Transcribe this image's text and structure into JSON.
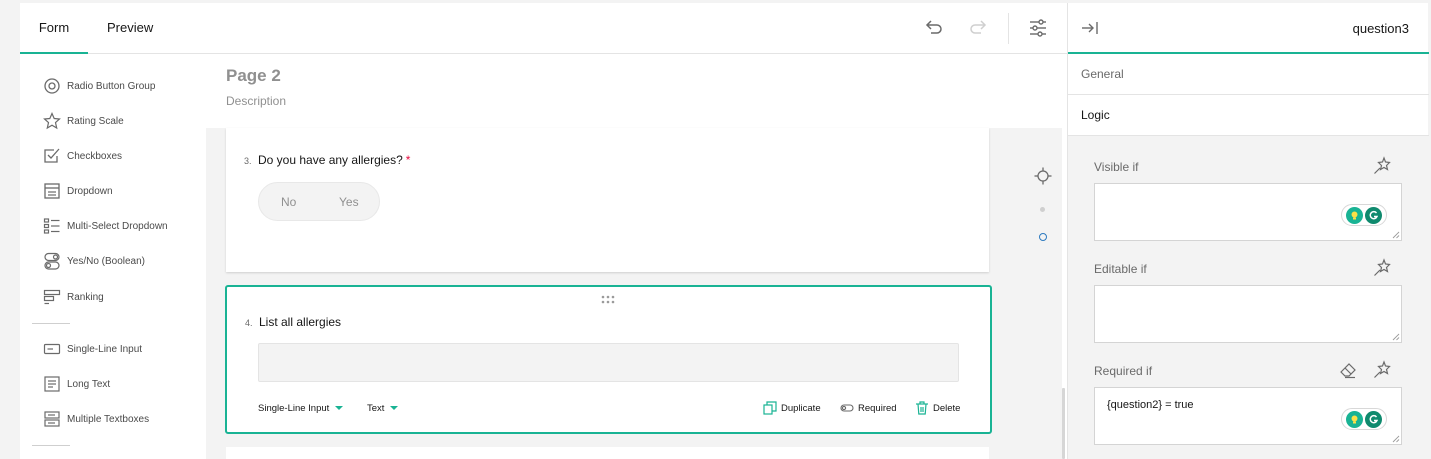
{
  "tabs": {
    "form": "Form",
    "preview": "Preview"
  },
  "toolbar": {
    "undo_icon": "undo-icon",
    "redo_icon": "redo-icon",
    "settings_icon": "sliders-icon"
  },
  "toolbox": {
    "items": [
      {
        "label": "Radio Button Group",
        "icon": "radio-group-icon"
      },
      {
        "label": "Rating Scale",
        "icon": "star-icon"
      },
      {
        "label": "Checkboxes",
        "icon": "checkbox-icon"
      },
      {
        "label": "Dropdown",
        "icon": "dropdown-icon"
      },
      {
        "label": "Multi-Select Dropdown",
        "icon": "multi-select-icon"
      },
      {
        "label": "Yes/No (Boolean)",
        "icon": "toggle-icon"
      },
      {
        "label": "Ranking",
        "icon": "ranking-icon"
      },
      {
        "label": "Single-Line Input",
        "icon": "single-line-input-icon"
      },
      {
        "label": "Long Text",
        "icon": "long-text-icon"
      },
      {
        "label": "Multiple Textboxes",
        "icon": "multiple-textboxes-icon"
      }
    ]
  },
  "page": {
    "title": "Page 2",
    "description": "Description"
  },
  "questions": [
    {
      "number": "3.",
      "title": "Do you have any allergies?",
      "required_mark": "*",
      "options": [
        "No",
        "Yes"
      ]
    },
    {
      "number": "4.",
      "title": "List all allergies",
      "input_value": "",
      "type_selector": "Single-Line Input",
      "input_type_selector": "Text",
      "actions": {
        "duplicate": "Duplicate",
        "required": "Required",
        "delete": "Delete"
      }
    }
  ],
  "property_grid": {
    "title": "question3",
    "sections": {
      "general": "General",
      "logic": "Logic"
    },
    "props": [
      {
        "label": "Visible if",
        "value": ""
      },
      {
        "label": "Editable if",
        "value": ""
      },
      {
        "label": "Required if",
        "value": "{question2} = true"
      }
    ]
  },
  "colors": {
    "accent": "#19b394",
    "required": "#e60a3e",
    "grammarly": "#15c39a"
  }
}
